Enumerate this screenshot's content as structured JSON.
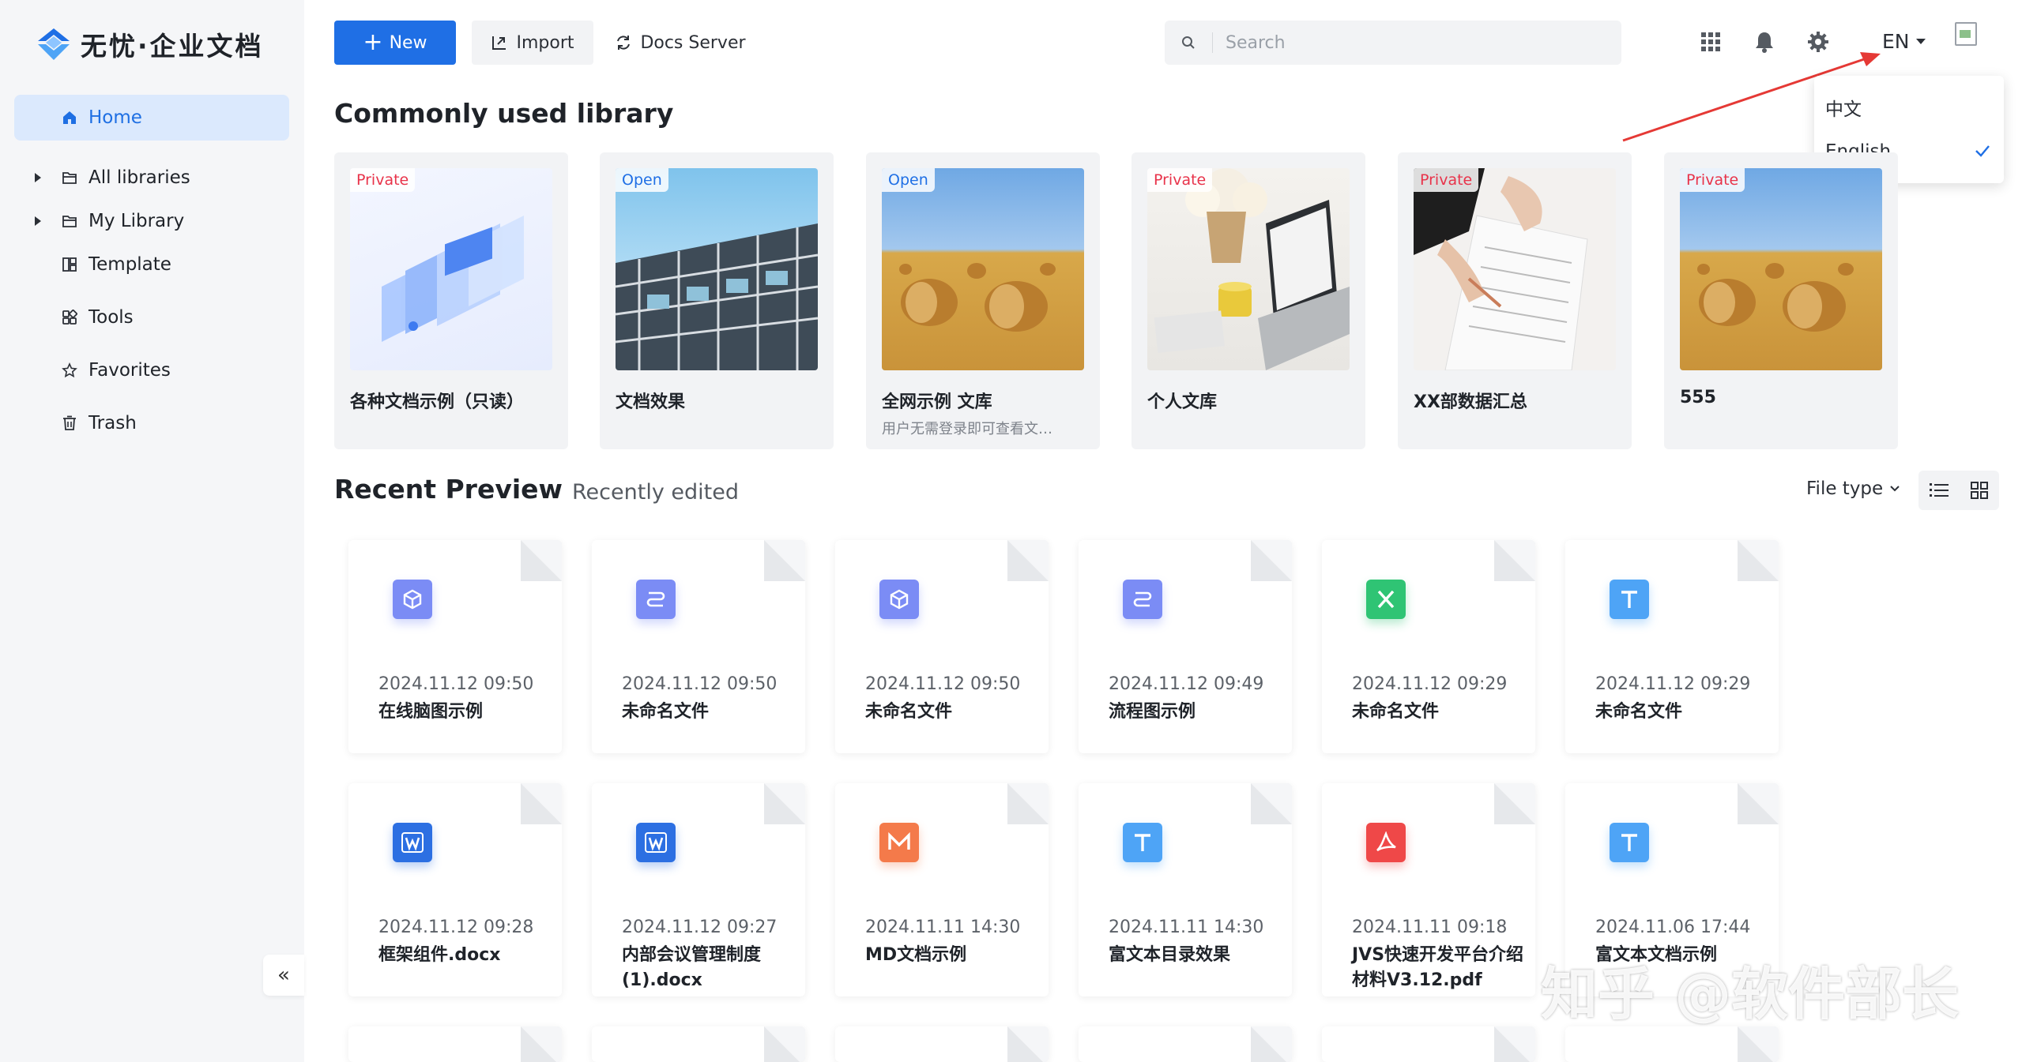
{
  "brand": {
    "logo_text": "无忧·企业文档"
  },
  "sidebar": {
    "items": [
      {
        "label": "Home",
        "icon": "home-icon",
        "active": true
      },
      {
        "label": "All libraries",
        "icon": "folder-icon",
        "expandable": true
      },
      {
        "label": "My Library",
        "icon": "folder-icon",
        "expandable": true
      },
      {
        "label": "Template",
        "icon": "template-icon"
      },
      {
        "label": "Tools",
        "icon": "tools-icon"
      },
      {
        "label": "Favorites",
        "icon": "star-icon"
      },
      {
        "label": "Trash",
        "icon": "trash-icon"
      }
    ],
    "collapse_glyph": "«"
  },
  "toolbar": {
    "new_label": "New",
    "import_label": "Import",
    "docs_server_label": "Docs Server",
    "search_placeholder": "Search",
    "lang_label": "EN"
  },
  "lang_menu": {
    "options": [
      {
        "label": "中文",
        "selected": false
      },
      {
        "label": "English",
        "selected": true
      }
    ]
  },
  "libraries": {
    "title": "Commonly used library",
    "items": [
      {
        "badge": "Private",
        "name": "各种文档示例（只读）",
        "desc": ""
      },
      {
        "badge": "Open",
        "name": "文档效果",
        "desc": ""
      },
      {
        "badge": "Open",
        "name": "全网示例 文库",
        "desc": "用户无需登录即可查看文…"
      },
      {
        "badge": "Private",
        "name": "个人文库",
        "desc": ""
      },
      {
        "badge": "Private",
        "name": "XX部数据汇总",
        "desc": ""
      },
      {
        "badge": "Private",
        "name": "555",
        "desc": ""
      }
    ]
  },
  "recent": {
    "title": "Recent Preview",
    "tab_edited": "Recently edited",
    "file_type_label": "File type",
    "files": [
      {
        "time": "2024.11.12 09:50",
        "name": "在线脑图示例",
        "type": "mindmap",
        "color": "#7b8cf5"
      },
      {
        "time": "2024.11.12 09:50",
        "name": "未命名文件",
        "type": "flow",
        "color": "#7b8cf5"
      },
      {
        "time": "2024.11.12 09:50",
        "name": "未命名文件",
        "type": "mindmap",
        "color": "#7b8cf5"
      },
      {
        "time": "2024.11.12 09:49",
        "name": "流程图示例",
        "type": "flow",
        "color": "#7b8cf5"
      },
      {
        "time": "2024.11.12 09:29",
        "name": "未命名文件",
        "type": "excel",
        "color": "#2fc474"
      },
      {
        "time": "2024.11.12 09:29",
        "name": "未命名文件",
        "type": "text",
        "color": "#4ea4f6"
      },
      {
        "time": "2024.11.12 09:28",
        "name": "框架组件.docx",
        "type": "word",
        "color": "#2c6fe2"
      },
      {
        "time": "2024.11.12 09:27",
        "name": "内部会议管理制度(1).docx",
        "type": "word",
        "color": "#2c6fe2"
      },
      {
        "time": "2024.11.11 14:30",
        "name": "MD文档示例",
        "type": "markdown",
        "color": "#f47a4a"
      },
      {
        "time": "2024.11.11 14:30",
        "name": "富文本目录效果",
        "type": "text",
        "color": "#4ea4f6"
      },
      {
        "time": "2024.11.11 09:18",
        "name": "JVS快速开发平台介绍材料V3.12.pdf",
        "type": "pdf",
        "color": "#ef4848"
      },
      {
        "time": "2024.11.06 17:44",
        "name": "富文本文档示例",
        "type": "text",
        "color": "#4ea4f6"
      }
    ]
  },
  "watermark": "知乎 @软件部长"
}
